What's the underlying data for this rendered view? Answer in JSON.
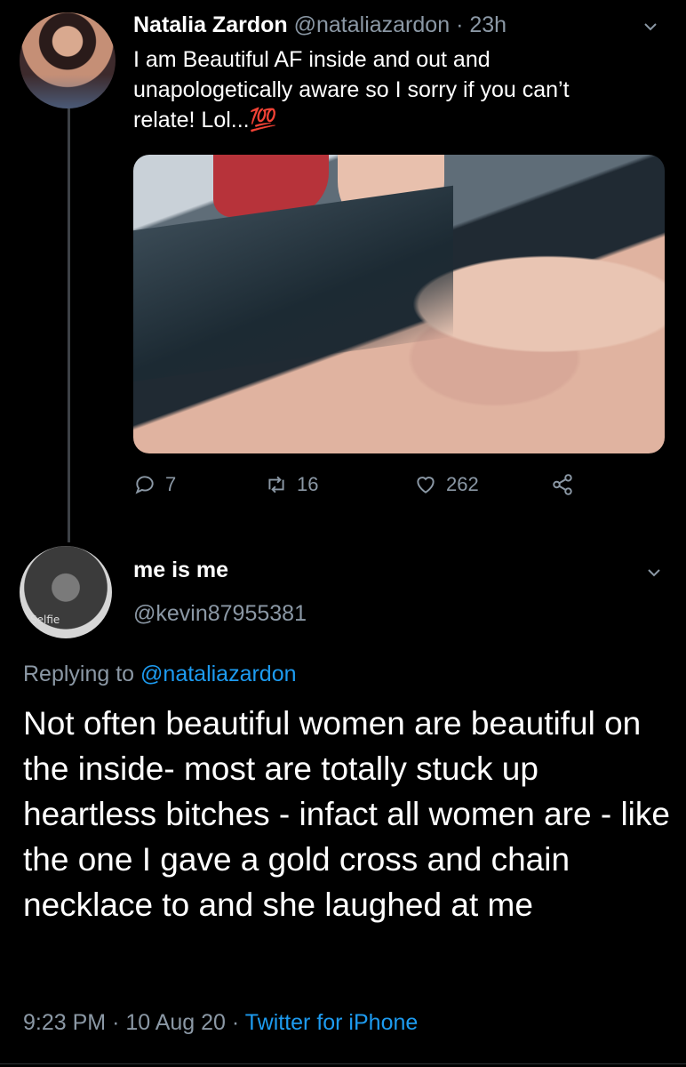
{
  "tweet1": {
    "display_name": "Natalia Zardon",
    "handle": "@nataliazardon",
    "separator": "·",
    "time": "23h",
    "text": "I am Beautiful AF inside and out and unapologetically aware so I sorry if you can’t relate! Lol...💯",
    "actions": {
      "replies": "7",
      "retweets": "16",
      "likes": "262"
    }
  },
  "tweet2": {
    "display_name": "me is me",
    "handle": "@kevin87955381",
    "avatar_caption": "Selfie",
    "replying_prefix": "Replying to",
    "replying_to": "@nataliazardon",
    "text": "Not often beautiful women are beautiful on the inside- most are totally stuck up heartless bitches - infact all women are - like the one I gave a gold cross and chain necklace to and she laughed at me",
    "time": "9:23 PM",
    "separator": "·",
    "date": "10 Aug 20",
    "source": "Twitter for iPhone"
  },
  "icons": {
    "reply": "reply-icon",
    "retweet": "retweet-icon",
    "like": "heart-icon",
    "share": "share-icon",
    "caret": "chevron-down-icon"
  },
  "colors": {
    "background": "#000000",
    "muted": "#8b98a5",
    "link": "#1d9bf0"
  }
}
